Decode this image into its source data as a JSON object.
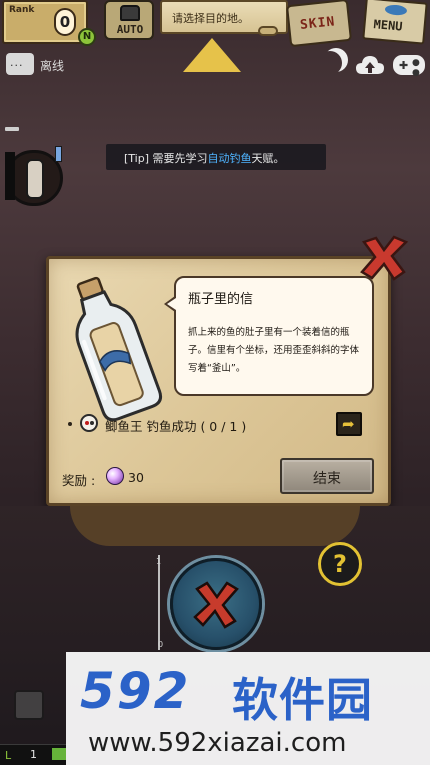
{
  "hud": {
    "rank_label": "Rank",
    "rank_value": "0",
    "n_badge": "N",
    "auto_label": "AUTO",
    "destination_prompt": "请选择目的地。",
    "skin_label": "SKIN",
    "menu_label": "MENU"
  },
  "status": {
    "chat_dots": "···",
    "offline_label": "离线",
    "pad_cross": "✚",
    "pad_dots": "● ●"
  },
  "tip": {
    "prefix": "[Tip] 需要先学习",
    "highlight": "自动钓鱼",
    "suffix": "天赋。"
  },
  "quest": {
    "title": "瓶子里的信",
    "description": "抓上来的鱼的肚子里有一个装着信的瓶子。信里有个坐标，还用歪歪斜斜的字体写着“釜山”。",
    "bullet": "·",
    "task": "鲫鱼王 钓鱼成功 ( 0 / 1 )",
    "reward_label": "奖励 :",
    "reward_value": "30",
    "end_button": "结束"
  },
  "controls": {
    "help_label": "?",
    "scale_top": "1",
    "scale_bottom": "0",
    "level_icon": "L",
    "level_value": "1"
  },
  "watermark": {
    "logo_num": "592",
    "logo_cn": "软件园",
    "url": "www.592xiazai.com"
  },
  "colors": {
    "tip_highlight": "#4fb4ff",
    "accent_gold": "#e2c233",
    "watermark_blue": "#2b62c8"
  }
}
